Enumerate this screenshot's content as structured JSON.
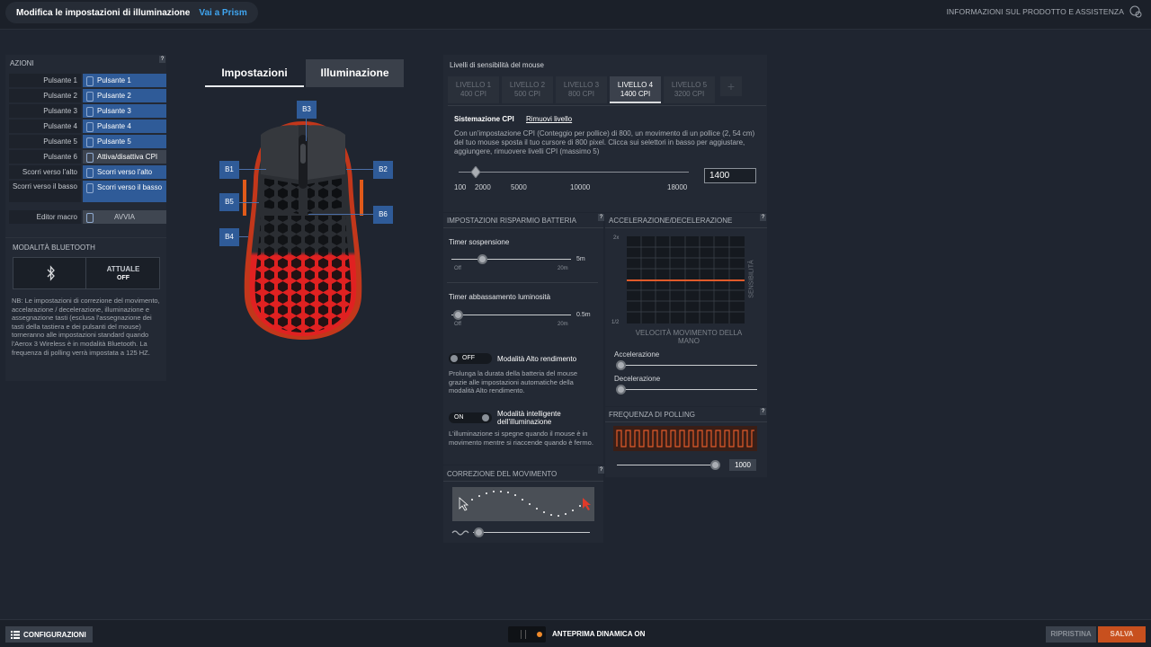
{
  "header": {
    "title": "Modifica le impostazioni di illuminazione",
    "prism_link": "Vai a Prism",
    "help": "INFORMAZIONI SUL PRODOTTO E ASSISTENZA"
  },
  "actions": {
    "title": "AZIONI",
    "rows": [
      {
        "label": "Pulsante 1",
        "value": "Pulsante 1"
      },
      {
        "label": "Pulsante 2",
        "value": "Pulsante 2"
      },
      {
        "label": "Pulsante 3",
        "value": "Pulsante 3"
      },
      {
        "label": "Pulsante 4",
        "value": "Pulsante 4"
      },
      {
        "label": "Pulsante 5",
        "value": "Pulsante 5"
      },
      {
        "label": "Pulsante 6",
        "value": "Attiva/disattiva CPI"
      },
      {
        "label": "Scorri verso l'alto",
        "value": "Scorri verso l'alto"
      },
      {
        "label": "Scorri verso il basso",
        "value": "Scorri verso il basso"
      }
    ],
    "macro_label": "Editor macro",
    "macro_button": "AVVIA"
  },
  "bluetooth": {
    "title": "MODALITÀ BLUETOOTH",
    "state_label": "ATTUALE",
    "state_value": "OFF",
    "note": "NB: Le impostazioni di correzione del movimento, accelarazione / decelerazione, illuminazione e assegnazione tasti (esclusa l'assegnazione dei tasti della tastiera e dei pulsanti del mouse) torneranno alle impostazioni standard quando l'Aerox 3 Wireless è in modalità Bluetooth. La frequenza di polling verrà impostata a 125 HZ."
  },
  "tabs": {
    "settings": "Impostazioni",
    "lighting": "Illuminazione"
  },
  "mouse_buttons": {
    "b1": "B1",
    "b2": "B2",
    "b3": "B3",
    "b4": "B4",
    "b5": "B5",
    "b6": "B6"
  },
  "cpi": {
    "title": "Livelli di sensibilità del mouse",
    "levels": [
      {
        "name": "LIVELLO 1",
        "value": "400 CPI"
      },
      {
        "name": "LIVELLO 2",
        "value": "500 CPI"
      },
      {
        "name": "LIVELLO 3",
        "value": "800 CPI"
      },
      {
        "name": "LIVELLO 4",
        "value": "1400 CPI"
      },
      {
        "name": "LIVELLO 5",
        "value": "3200 CPI"
      }
    ],
    "active_level": 4,
    "add": "+",
    "setting_label": "Sistemazione CPI",
    "remove_label": "Rimuovi livello",
    "description": "Con un'impostazione CPI (Conteggio per pollice) di 800, un movimento di un pollice (2, 54 cm) del tuo mouse sposta il tuo cursore di 800 pixel. Clicca sui selettori in basso per aggiustare, aggiungere, rimuovere livelli CPI (massimo 5)",
    "ticks": [
      "100",
      "2000",
      "5000",
      "10000",
      "18000"
    ],
    "input_value": "1400"
  },
  "battery": {
    "title": "IMPOSTAZIONI RISPARMIO BATTERIA",
    "sleep_label": "Timer sospensione",
    "sleep_value": "5m",
    "sleep_min": "Off",
    "sleep_max": "20m",
    "dim_label": "Timer abbassamento luminosità",
    "dim_value": "0.5m",
    "dim_min": "Off",
    "dim_max": "20m",
    "high_perf_toggle": "OFF",
    "high_perf_label": "Modalità Alto rendimento",
    "high_perf_desc": "Prolunga la durata della batteria del mouse grazie alle impostazioni automatiche della modalità Alto rendimento.",
    "smart_toggle": "ON",
    "smart_label": "Modalità intelligente dell'illuminazione",
    "smart_desc": "L'illuminazione si spegne quando il mouse è in movimento mentre si riaccende quando è fermo."
  },
  "accel": {
    "title": "ACCELERAZIONE/DECELERAZIONE",
    "y_top": "2x",
    "y_bottom": "1/2",
    "side_label": "SENSIBILITÀ",
    "x_label": "VELOCITÀ MOVIMENTO DELLA MANO",
    "accel_label": "Accelerazione",
    "decel_label": "Decelerazione"
  },
  "polling": {
    "title": "FREQUENZA DI POLLING",
    "value": "1000"
  },
  "correction": {
    "title": "CORREZIONE DEL MOVIMENTO"
  },
  "footer": {
    "configs": "CONFIGURAZIONI",
    "preview": "ANTEPRIMA DINAMICA ON",
    "reset": "RIPRISTINA",
    "save": "SALVA"
  },
  "colors": {
    "accent": "#3fa5f0",
    "orange": "#e05a2a",
    "button_blue": "#2f5b98"
  }
}
